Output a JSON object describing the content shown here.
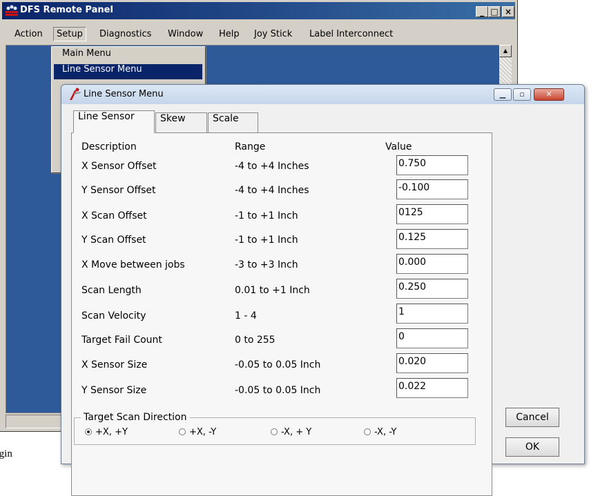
{
  "main_window": {
    "title": "DFS Remote Panel",
    "menu": [
      "Action",
      "Setup",
      "Diagnostics",
      "Window",
      "Help",
      "Joy Stick",
      "Label Interconnect"
    ],
    "controls": {
      "minimize": "_",
      "maximize": "□",
      "close": "×"
    }
  },
  "setup_menu": {
    "items": [
      "Main Menu",
      "Line Sensor Menu"
    ],
    "selected": "Line Sensor Menu"
  },
  "dialog": {
    "title": "Line Sensor Menu",
    "tabs": [
      "Line Sensor",
      "Skew",
      "Scale"
    ],
    "active_tab": "Line Sensor",
    "headers": {
      "description": "Description",
      "range": "Range",
      "value": "Value"
    },
    "rows": [
      {
        "description": "X Sensor Offset",
        "range": "-4 to +4 Inches",
        "value": "0.750"
      },
      {
        "description": "Y Sensor Offset",
        "range": "-4 to +4 Inches",
        "value": "-0.100"
      },
      {
        "description": "X Scan Offset",
        "range": "-1 to +1 Inch",
        "value": "0125"
      },
      {
        "description": "Y Scan Offset",
        "range": "-1 to +1 Inch",
        "value": "0.125"
      },
      {
        "description": "X Move between jobs",
        "range": "-3 to +3 Inch",
        "value": "0.000"
      },
      {
        "description": "Scan Length",
        "range": "0.01 to +1 Inch",
        "value": "0.250"
      },
      {
        "description": "Scan Velocity",
        "range": "1 - 4",
        "value": "1"
      },
      {
        "description": "Target Fail Count",
        "range": "0 to 255",
        "value": "0"
      },
      {
        "description": "X Sensor Size",
        "range": "-0.05 to 0.05 Inch",
        "value": "0.020"
      },
      {
        "description": "Y Sensor Size",
        "range": "-0.05 to 0.05 Inch",
        "value": "0.022"
      }
    ],
    "scan_direction": {
      "label": "Target Scan Direction",
      "options": [
        "+X, +Y",
        "+X, -Y",
        "-X, + Y",
        "-X, -Y"
      ],
      "selected": "+X, +Y"
    },
    "buttons": {
      "cancel": "Cancel",
      "ok": "OK"
    }
  },
  "background_caption": "origin",
  "colors": {
    "title_active": "#0a246a",
    "client_bg": "#2e5a9a",
    "menu_highlight": "#0a246a"
  }
}
